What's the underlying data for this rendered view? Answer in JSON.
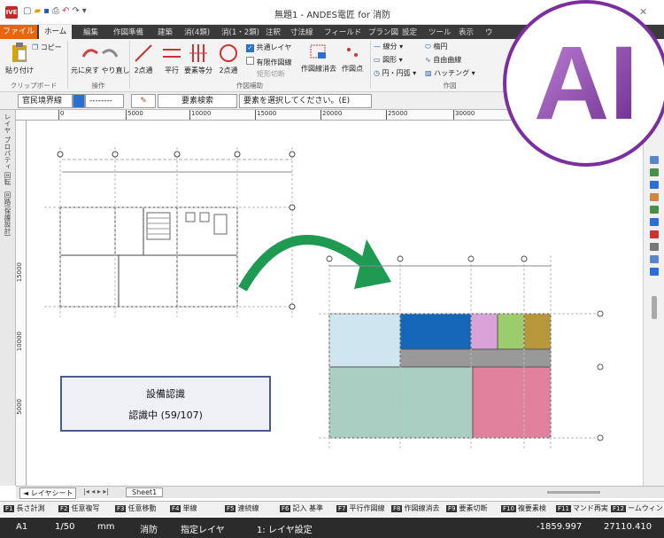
{
  "window": {
    "title": "無題1 - ANDES電匠 for 消防",
    "app_icon": "IVE"
  },
  "tabs": [
    "ファイル",
    "ホーム",
    "編集",
    "作図準備",
    "建築",
    "消(4類)",
    "消(1・2類)",
    "注釈",
    "寸法線",
    "フィールド",
    "プラン図",
    "設定",
    "ツール",
    "表示",
    "ウ"
  ],
  "ribbon": {
    "paste": "貼り付け",
    "copy": "コピー",
    "undo_redo": "元に戻す やり直し",
    "line2pt": "2点通",
    "parallel": "平行",
    "elem_equal": "要素等分",
    "circle2pt": "2点通",
    "common_layer": "共通レイヤ",
    "limited_draw": "有限作図線",
    "rect_cut": "矩形切断",
    "draw_erase": "作図線消去",
    "draw_point": "作図点",
    "lines_label": "線分",
    "circle_label": "円・円弧",
    "shape_label": "図形",
    "hatch_label": "ハッチング",
    "ellipse_label": "楕円",
    "freecurve_label": "自由曲線",
    "group_clipboard": "クリップボード",
    "group_ops": "操作",
    "group_aux": "作図補助",
    "group_draw": "作図"
  },
  "propbar": {
    "layer": "官民境界線",
    "linestyle": "--------",
    "elem_search": "要素検索",
    "prompt": "要素を選択してください。(E)"
  },
  "ruler_ticks": [
    "0",
    "5000",
    "10000",
    "15000",
    "20000",
    "25000",
    "30000"
  ],
  "vruler_ticks": [
    "15000",
    "10000",
    "5000"
  ],
  "left_panel": [
    "レイヤ",
    "プロパティ",
    "回転",
    "回路(保護設計)"
  ],
  "sheet": {
    "nav": "◄ レイヤシート",
    "name": "Sheet1"
  },
  "dialog": {
    "title": "設備認識",
    "progress": "認識中 (59/107)"
  },
  "fkeys": [
    {
      "k": "F1",
      "label": "長さ計測"
    },
    {
      "k": "F2",
      "label": "任意複写"
    },
    {
      "k": "F3",
      "label": "任意移動"
    },
    {
      "k": "F4",
      "label": "単線"
    },
    {
      "k": "F5",
      "label": "連続線"
    },
    {
      "k": "F6",
      "label": "記入 基準"
    },
    {
      "k": "F7",
      "label": "平行作図線"
    },
    {
      "k": "F8",
      "label": "作図線消去"
    },
    {
      "k": "F9",
      "label": "要素切断"
    },
    {
      "k": "F10",
      "label": "複要素検"
    },
    {
      "k": "F11",
      "label": "マンド再実"
    },
    {
      "k": "F12",
      "label": "ームウィン"
    }
  ],
  "status": {
    "paper": "A1",
    "scale": "1/50",
    "unit": "mm",
    "category": "消防",
    "layer_mode": "指定レイヤ",
    "layer": "1: レイヤ設定",
    "coord_x": "-1859.997",
    "coord_y": "27110.410"
  },
  "ai_badge": "AI",
  "colors": {
    "orange": "#e8650f",
    "purple": "#7b2f9e",
    "arrow": "#1e9a52"
  }
}
